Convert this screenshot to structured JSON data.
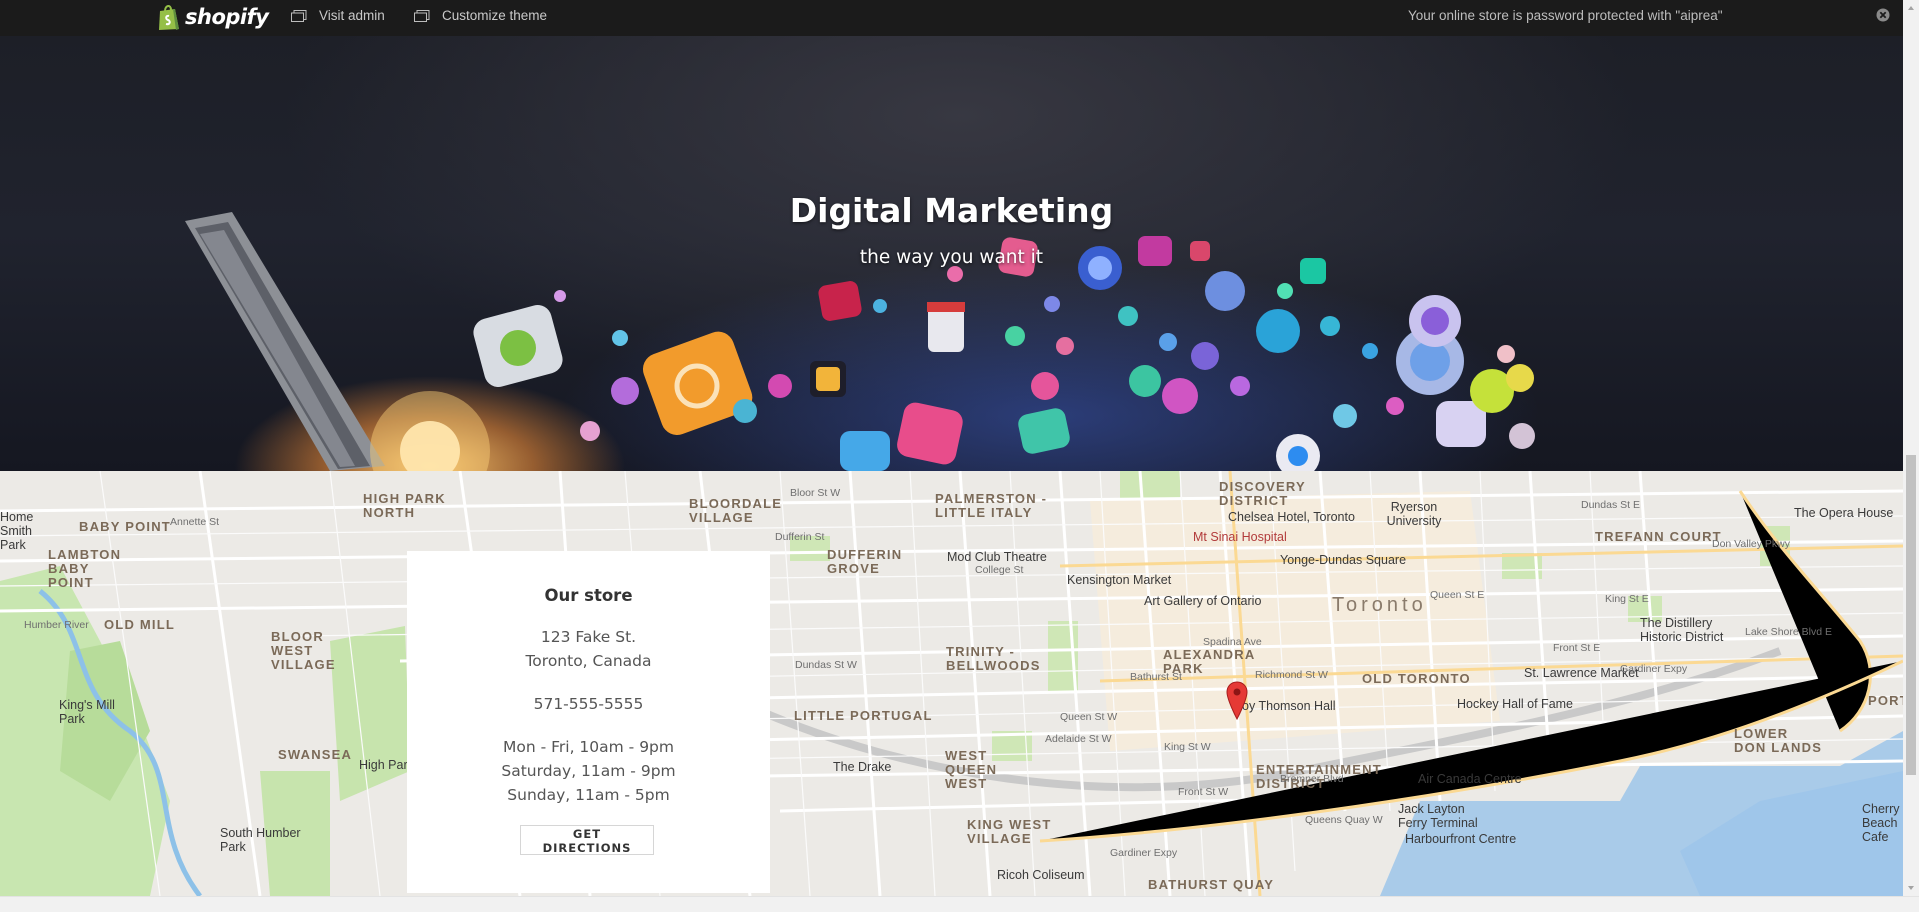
{
  "admin_bar": {
    "brand": "shopify",
    "visit_admin": "Visit admin",
    "customize_theme": "Customize theme",
    "password_notice": "Your online store is password protected with \"aiprea\"",
    "icons": {
      "brand": "shopify-bag-icon",
      "visit": "window-icon",
      "customize": "window-icon",
      "close": "close-icon"
    }
  },
  "hero": {
    "title": "Digital Marketing",
    "subtitle": "the way you want it"
  },
  "store": {
    "title": "Our store",
    "address_line1": "123 Fake St.",
    "address_line2": "Toronto, Canada",
    "phone": "571-555-5555",
    "hours_weekday": "Mon - Fri, 10am - 9pm",
    "hours_saturday": "Saturday, 11am - 9pm",
    "hours_sunday": "Sunday, 11am - 5pm",
    "directions_button": "GET DIRECTIONS"
  },
  "map_labels": {
    "baby_point": "BABY POINT",
    "lambton": "LAMBTON BABY POINT",
    "high_park_north": "HIGH PARK NORTH",
    "bloordale": "BLOORDALE VILLAGE",
    "palmerston": "PALMERSTON - LITTLE ITALY",
    "discovery": "DISCOVERY DISTRICT",
    "trefann": "TREFANN COURT",
    "dufferin_grove": "DUFFERIN GROVE",
    "old_mill": "OLD MILL",
    "bloor_west": "BLOOR WEST VILLAGE",
    "trinity": "TRINITY - BELLWOODS",
    "alexandra": "ALEXANDRA PARK",
    "old_toronto": "OLD TORONTO",
    "little_portugal": "LITTLE PORTUGAL",
    "swansea": "SWANSEA",
    "west_queen_west": "WEST QUEEN WEST",
    "entertainment": "ENTERTAINMENT DISTRICT",
    "king_west": "KING WEST VILLAGE",
    "lower_don": "LOWER DON LANDS",
    "port": "PORT",
    "bathurst_quay": "BATHURST QUAY",
    "toronto": "Toronto",
    "mt_sinai": "Mt Sinai Hospital",
    "chelsea": "Chelsea Hotel, Toronto",
    "ryerson": "Ryerson University",
    "opera": "The Opera House",
    "mod_club": "Mod Club Theatre",
    "kensington": "Kensington Market",
    "ago": "Art Gallery of Ontario",
    "yonge_dundas": "Yonge-Dundas Square",
    "distillery": "The Distillery Historic District",
    "st_lawrence": "St. Lawrence Market",
    "hockey": "Hockey Hall of Fame",
    "roy_thomson": "Roy Thomson Hall",
    "the_drake": "The Drake",
    "air_canada": "Air Canada Centre",
    "jack_layton": "Jack Layton Ferry Terminal",
    "harbourfront": "Harbourfront Centre",
    "ricoh": "Ricoh Coliseum",
    "kings_mill": "King's Mill Park",
    "south_humber": "South Humber Park",
    "high_park": "High Park",
    "home_smith": "Home Smith Park",
    "cherry": "Cherry Beach Cafe",
    "humber_river": "Humber River",
    "gardiner": "Gardiner Expy",
    "queen_st_w": "Queen St W",
    "dundas_st_w": "Dundas St W",
    "king_st_w": "King St W",
    "bloor_st_w": "Bloor St W",
    "college_st": "College St",
    "front_st_w": "Front St W",
    "queens_quay": "Queens Quay W",
    "adelaide": "Adelaide St W",
    "richmond": "Richmond St W",
    "dundas_st_e": "Dundas St E",
    "queen_st_e": "Queen St E",
    "king_st_e": "King St E",
    "front_st_e": "Front St E",
    "lake_shore": "Lake Shore Blvd E",
    "don_valley": "Don Valley Pkwy",
    "annette": "Annette St",
    "bremner": "Bremner Blvd",
    "spadina": "Spadina Ave",
    "bathurst": "Bathurst St",
    "dufferin": "Dufferin St"
  }
}
